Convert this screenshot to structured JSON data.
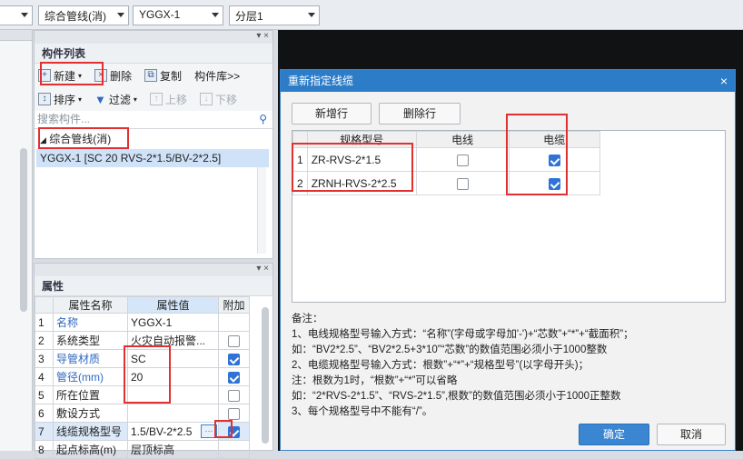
{
  "toolbar": {
    "select1": "",
    "select2": "综合管线(消)",
    "select3": "YGGX-1",
    "select4": "分层1"
  },
  "component_list": {
    "title": "构件列表",
    "actions": {
      "new": "新建",
      "delete": "删除",
      "copy": "复制",
      "library": "构件库>>",
      "sort": "排序",
      "filter": "过滤",
      "move_up": "上移",
      "move_down": "下移"
    },
    "search_placeholder": "搜索构件...",
    "tree_parent": "综合管线(消)",
    "tree_child": "YGGX-1 [SC 20 RVS-2*1.5/BV-2*2.5]"
  },
  "properties": {
    "title": "属性",
    "headers": [
      "属性名称",
      "属性值",
      "附加"
    ],
    "rows": [
      {
        "n": "1",
        "name": "名称",
        "value": "YGGX-1"
      },
      {
        "n": "2",
        "name": "系统类型",
        "value": "火灾自动报警..."
      },
      {
        "n": "3",
        "name": "导管材质",
        "value": "SC"
      },
      {
        "n": "4",
        "name": "管径(mm)",
        "value": "20"
      },
      {
        "n": "5",
        "name": "所在位置",
        "value": ""
      },
      {
        "n": "6",
        "name": "敷设方式",
        "value": ""
      },
      {
        "n": "7",
        "name": "线缆规格型号",
        "value": "1.5/BV-2*2.5"
      },
      {
        "n": "8",
        "name": "起点标高(m)",
        "value": "层顶标高"
      }
    ],
    "more_glyph": "···"
  },
  "dialog": {
    "title": "重新指定线缆",
    "close_glyph": "×",
    "add_row": "新增行",
    "delete_row": "删除行",
    "headers": [
      "规格型号",
      "电线",
      "电缆"
    ],
    "rows": [
      {
        "n": "1",
        "spec": "ZR-RVS-2*1.5"
      },
      {
        "n": "2",
        "spec": "ZRNH-RVS-2*2.5"
      }
    ],
    "notes": [
      "备注：",
      "1、电线规格型号输入方式：“名称”(字母或字母加'-')+“芯数”+“*”+“截面积”；",
      "如：“BV2*2.5”、“BV2*2.5+3*10”“芯数”的数值范围必须小于1000整数",
      "2、电缆规格型号输入方式：根数”+“*”+“规格型号”(以字母开头)；",
      "注：根数为1时，“根数”+“*”可以省略",
      "如：“2*RVS-2*1.5”、“RVS-2*1.5”,根数”的数值范围必须小于1000正整数",
      "3、每个规格型号中不能有“/”。"
    ],
    "ok": "确定",
    "cancel": "取消"
  },
  "colors": {
    "accent": "#2c7cc8",
    "highlight": "#e03030",
    "selection": "#cfe2f7"
  }
}
